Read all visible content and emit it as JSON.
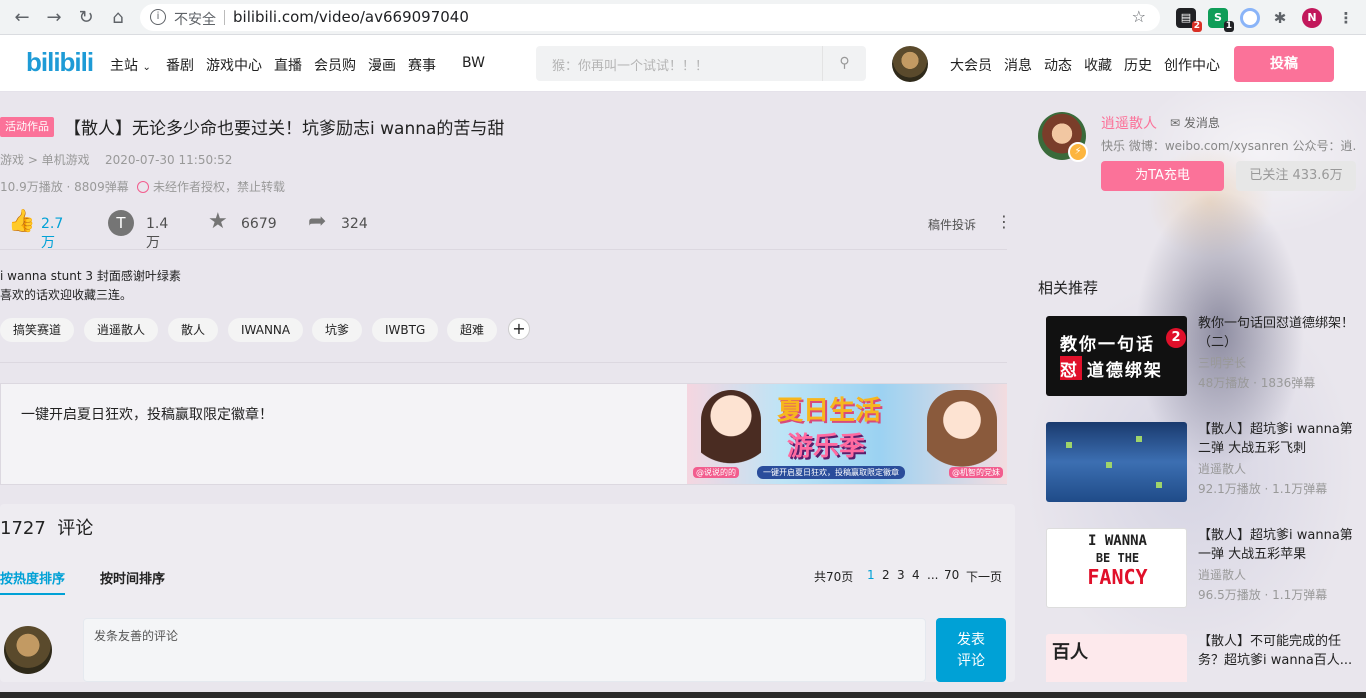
{
  "browser": {
    "insecure_label": "不安全",
    "url": "bilibili.com/video/av669097040",
    "ext_badges": [
      "2",
      "1"
    ],
    "profile_letter": "N"
  },
  "header": {
    "logo": "bilibili",
    "nav": [
      "主站",
      "番剧",
      "游戏中心",
      "直播",
      "会员购",
      "漫画",
      "赛事",
      "BW"
    ],
    "search_placeholder": "猴：你再叫一个试试！！！",
    "user_links": [
      "大会员",
      "消息",
      "动态",
      "收藏",
      "历史",
      "创作中心"
    ],
    "upload_label": "投稿"
  },
  "video": {
    "badge": "活动作品",
    "title": "【散人】无论多少命也要过关！坑爹励志i wanna的苦与甜",
    "category": "游戏 > 单机游戏",
    "date": "2020-07-30 11:50:52",
    "plays": "10.9万播放 · 8809弹幕",
    "copyright": "未经作者授权，禁止转载",
    "like": "2.7万",
    "coin": "1.4万",
    "fav": "6679",
    "share": "324",
    "report": "稿件投诉",
    "desc": [
      "i wanna stunt 3 封面感谢叶绿素",
      "喜欢的话欢迎收藏三连。"
    ],
    "tags": [
      "搞笑赛道",
      "逍遥散人",
      "散人",
      "IWANNA",
      "坑爹",
      "IWBTG",
      "超难"
    ]
  },
  "banner": {
    "text": "一键开启夏日狂欢，投稿赢取限定徽章！",
    "img_title1": "夏日生活",
    "img_title2": "游乐季",
    "img_sub": "一键开启夏日狂欢，投稿赢取限定徽章",
    "label_left": "@说说的的",
    "label_right": "@机智的党妹"
  },
  "comments": {
    "count": "1727",
    "label": "评论",
    "sort_hot": "按热度排序",
    "sort_time": "按时间排序",
    "pager_total": "共70页",
    "pages": [
      "1",
      "2",
      "3",
      "4",
      "...",
      "70"
    ],
    "next": "下一页",
    "placeholder": "发条友善的评论",
    "send": "发表\n评论"
  },
  "up": {
    "name": "逍遥散人",
    "msg": "发消息",
    "desc": "快乐 微博：weibo.com/xysanren 公众号：逍...",
    "charge": "为TA充电",
    "follow": "已关注 433.6万"
  },
  "related": {
    "title": "相关推荐",
    "items": [
      {
        "title": "教你一句话回怼道德绑架！（二）",
        "up": "三明学长",
        "stats": "48万播放 · 1836弹幕",
        "thumb_text1": "教你一句话",
        "thumb_text2": "怼 道德绑架",
        "thumb_badge": "2"
      },
      {
        "title": "【散人】超坑爹i wanna第二弹 大战五彩飞刺",
        "up": "逍遥散人",
        "stats": "92.1万播放 · 1.1万弹幕"
      },
      {
        "title": "【散人】超坑爹i wanna第一弹 大战五彩苹果",
        "up": "逍遥散人",
        "stats": "96.5万播放 · 1.1万弹幕",
        "thumb_lines": [
          "I WANNA",
          "BE THE",
          "FANCY"
        ]
      },
      {
        "title": "【散人】不可能完成的任务？超坑爹i wanna百人...",
        "up": "",
        "stats": "",
        "thumb_text": "百人"
      }
    ]
  },
  "colors": {
    "pink": "#fb7299",
    "blue": "#00a1d6"
  }
}
